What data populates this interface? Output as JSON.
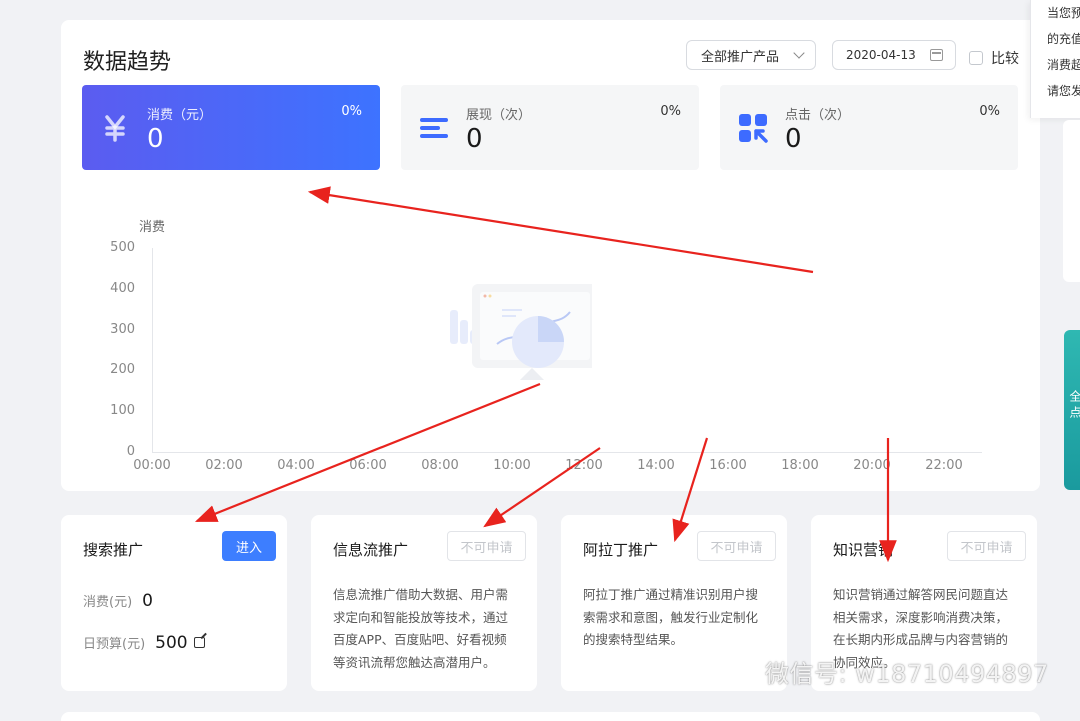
{
  "trend": {
    "title": "数据趋势",
    "product_select": "全部推广产品",
    "date": "2020-04-13",
    "compare_label": "比较"
  },
  "metrics": [
    {
      "label": "消费（元）",
      "value": "0",
      "pct": "0%",
      "icon": "yuan-icon"
    },
    {
      "label": "展现（次）",
      "value": "0",
      "pct": "0%",
      "icon": "bars-icon"
    },
    {
      "label": "点击（次）",
      "value": "0",
      "pct": "0%",
      "icon": "click-icon"
    }
  ],
  "chart_data": {
    "type": "line",
    "ylabel": "消费",
    "yticks": [
      "500",
      "400",
      "300",
      "200",
      "100",
      "0"
    ],
    "xticks": [
      "00:00",
      "02:00",
      "04:00",
      "06:00",
      "08:00",
      "10:00",
      "12:00",
      "14:00",
      "16:00",
      "18:00",
      "20:00",
      "22:00"
    ],
    "ylim": [
      0,
      500
    ],
    "series": [],
    "grid": false
  },
  "products": [
    {
      "title": "搜索推广",
      "button": "进入",
      "spend_label": "消费(元)",
      "spend_value": "0",
      "budget_label": "日预算(元)",
      "budget_value": "500"
    },
    {
      "title": "信息流推广",
      "button": "不可申请",
      "desc": "信息流推广借助大数据、用户需求定向和智能投放等技术，通过百度APP、百度贴吧、好看视频等资讯流帮您触达高潜用户。"
    },
    {
      "title": "阿拉丁推广",
      "button": "不可申请",
      "desc": "阿拉丁推广通过精准识别用户搜索需求和意图，触发行业定制化的搜索特型结果。"
    },
    {
      "title": "知识营销",
      "button": "不可申请",
      "desc": "知识营销通过解答网民问题直达相关需求，深度影响消费决策，在长期内形成品牌与内容营销的协同效应。"
    }
  ],
  "popover": {
    "lines": [
      "当您预",
      "的充值",
      "消费超",
      "请您发"
    ]
  },
  "side_tab": {
    "text": "全 点"
  },
  "watermark": {
    "text": "微信号: w18710494897"
  },
  "colors": {
    "primary": "#3d7eff",
    "arrow": "#e8231e"
  }
}
